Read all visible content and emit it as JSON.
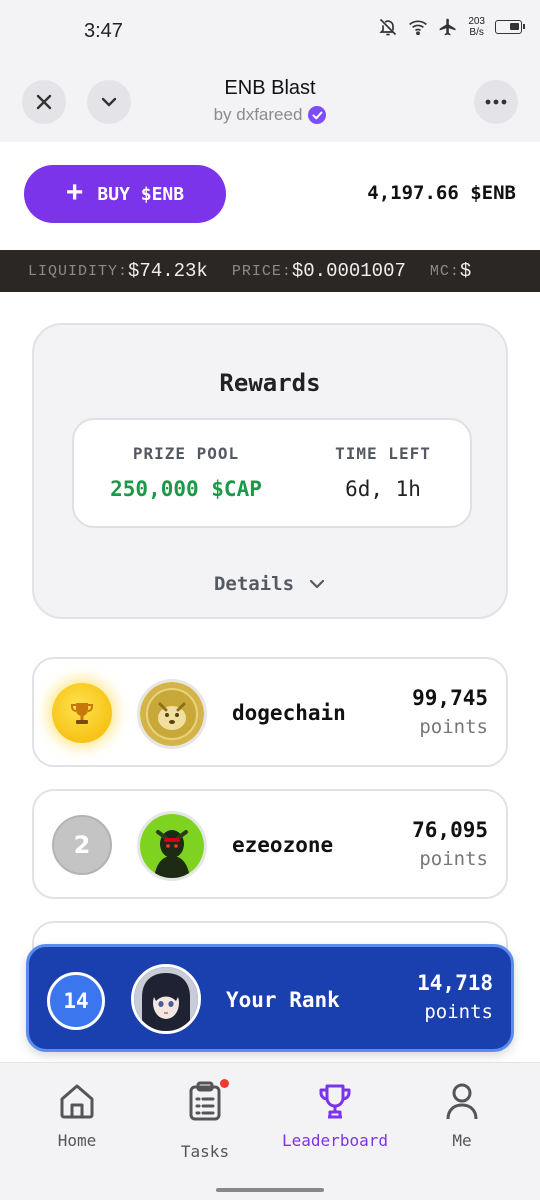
{
  "status_bar": {
    "time": "3:47",
    "net_speed_value": "203",
    "net_speed_unit": "B/s",
    "icons": [
      "bell-off-icon",
      "wifi-icon",
      "airplane-icon",
      "battery-icon"
    ]
  },
  "app_header": {
    "title": "ENB Blast",
    "subtitle": "by dxfareed",
    "icons": [
      "close-icon",
      "chevron-down-icon",
      "verified-icon",
      "more-icon"
    ]
  },
  "buy": {
    "label": "BUY $ENB",
    "plus": "+"
  },
  "balance": "4,197.66 $ENB",
  "ticker": {
    "liquidity_label": "LIQUIDITY:",
    "liquidity_value": "$74.23k",
    "price_label": "PRICE:",
    "price_value": "$0.0001007",
    "mc_label": "MC:",
    "mc_value": "$"
  },
  "rewards": {
    "title": "Rewards",
    "prize_pool_label": "PRIZE POOL",
    "prize_pool_value": "250,000 $CAP",
    "time_left_label": "TIME LEFT",
    "time_left_value": "6d, 1h",
    "details_label": "Details"
  },
  "leaderboard": [
    {
      "rank": "1",
      "name": "dogechain",
      "points": "99,745",
      "points_unit": "points"
    },
    {
      "rank": "2",
      "name": "ezeozone",
      "points": "76,095",
      "points_unit": "points"
    }
  ],
  "your_rank": {
    "rank": "14",
    "label": "Your Rank",
    "points": "14,718",
    "points_unit": "points"
  },
  "bottom_nav": {
    "items": [
      {
        "label": "Home",
        "icon": "home-icon"
      },
      {
        "label": "Tasks",
        "icon": "clipboard-icon"
      },
      {
        "label": "Leaderboard",
        "icon": "trophy-icon"
      },
      {
        "label": "Me",
        "icon": "user-icon"
      }
    ],
    "active": "Leaderboard"
  },
  "colors": {
    "accent_purple": "#7b34ea",
    "prize_green": "#1a9a48",
    "your_rank_blue": "#1a3fae",
    "ticker_bg": "#2b2725"
  }
}
